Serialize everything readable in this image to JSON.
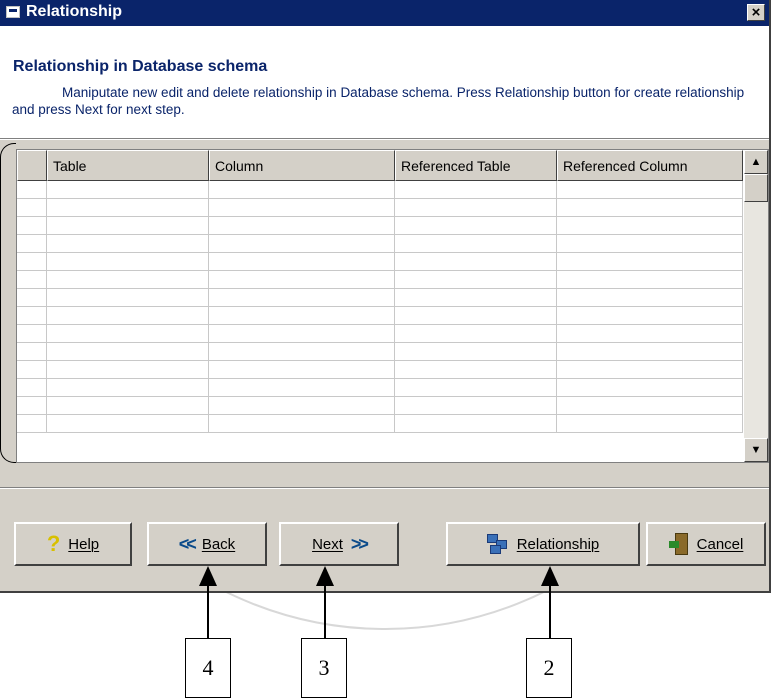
{
  "window": {
    "title": "Relationship",
    "close_label": "×"
  },
  "header": {
    "title": "Relationship in Database schema",
    "description": "Maniputate new edit and delete relationship in Database schema. Press Relationship button for create relationship and press Next for next step."
  },
  "grid": {
    "columns": [
      "Table",
      "Column",
      "Referenced Table",
      "Referenced Column"
    ],
    "row_count": 14
  },
  "buttons": {
    "help": "Help",
    "back": "Back",
    "next": "Next",
    "relationship": "Relationship",
    "cancel": "Cancel"
  },
  "annotations": {
    "relationship_marker": "2",
    "next_marker": "3",
    "back_marker": "4"
  }
}
